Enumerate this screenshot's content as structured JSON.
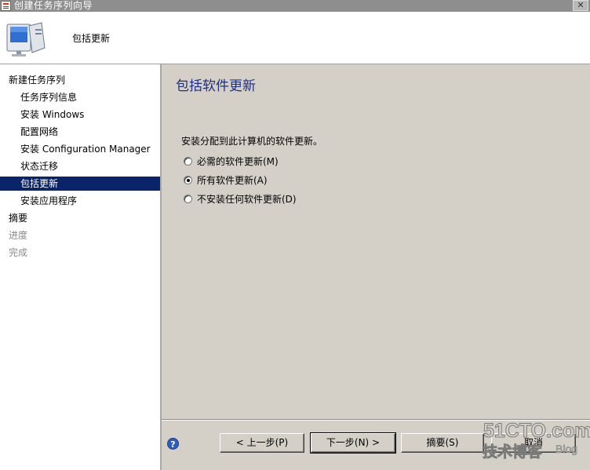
{
  "window": {
    "title": "创建任务序列向导",
    "close_glyph": "✕"
  },
  "header": {
    "title": "包括更新"
  },
  "sidebar": {
    "items": [
      {
        "label": "新建任务序列",
        "state": "normal"
      },
      {
        "label": "任务序列信息",
        "state": "normal"
      },
      {
        "label": "安装 Windows",
        "state": "normal"
      },
      {
        "label": "配置网络",
        "state": "normal"
      },
      {
        "label": "安装 Configuration Manager",
        "state": "normal"
      },
      {
        "label": "状态迁移",
        "state": "normal"
      },
      {
        "label": "包括更新",
        "state": "selected"
      },
      {
        "label": "安装应用程序",
        "state": "normal"
      },
      {
        "label": "摘要",
        "state": "normal"
      },
      {
        "label": "进度",
        "state": "disabled"
      },
      {
        "label": "完成",
        "state": "disabled"
      }
    ]
  },
  "main": {
    "title": "包括软件更新",
    "description": "安装分配到此计算机的软件更新。",
    "options": [
      {
        "label": "必需的软件更新(M)",
        "selected": false
      },
      {
        "label": "所有软件更新(A)",
        "selected": true
      },
      {
        "label": "不安装任何软件更新(D)",
        "selected": false
      }
    ]
  },
  "footer": {
    "help_glyph": "?",
    "prev_label": "< 上一步(P)",
    "next_label": "下一步(N) >",
    "summary_label": "摘要(S)",
    "cancel_label": "取消"
  },
  "watermark": {
    "line1": "51CTO.com",
    "line2": "技术博客",
    "line3": "Blog"
  },
  "colors": {
    "selection": "#0a246a",
    "title_blue": "#1f2f80",
    "dialog_bg": "#d4d0c8"
  }
}
